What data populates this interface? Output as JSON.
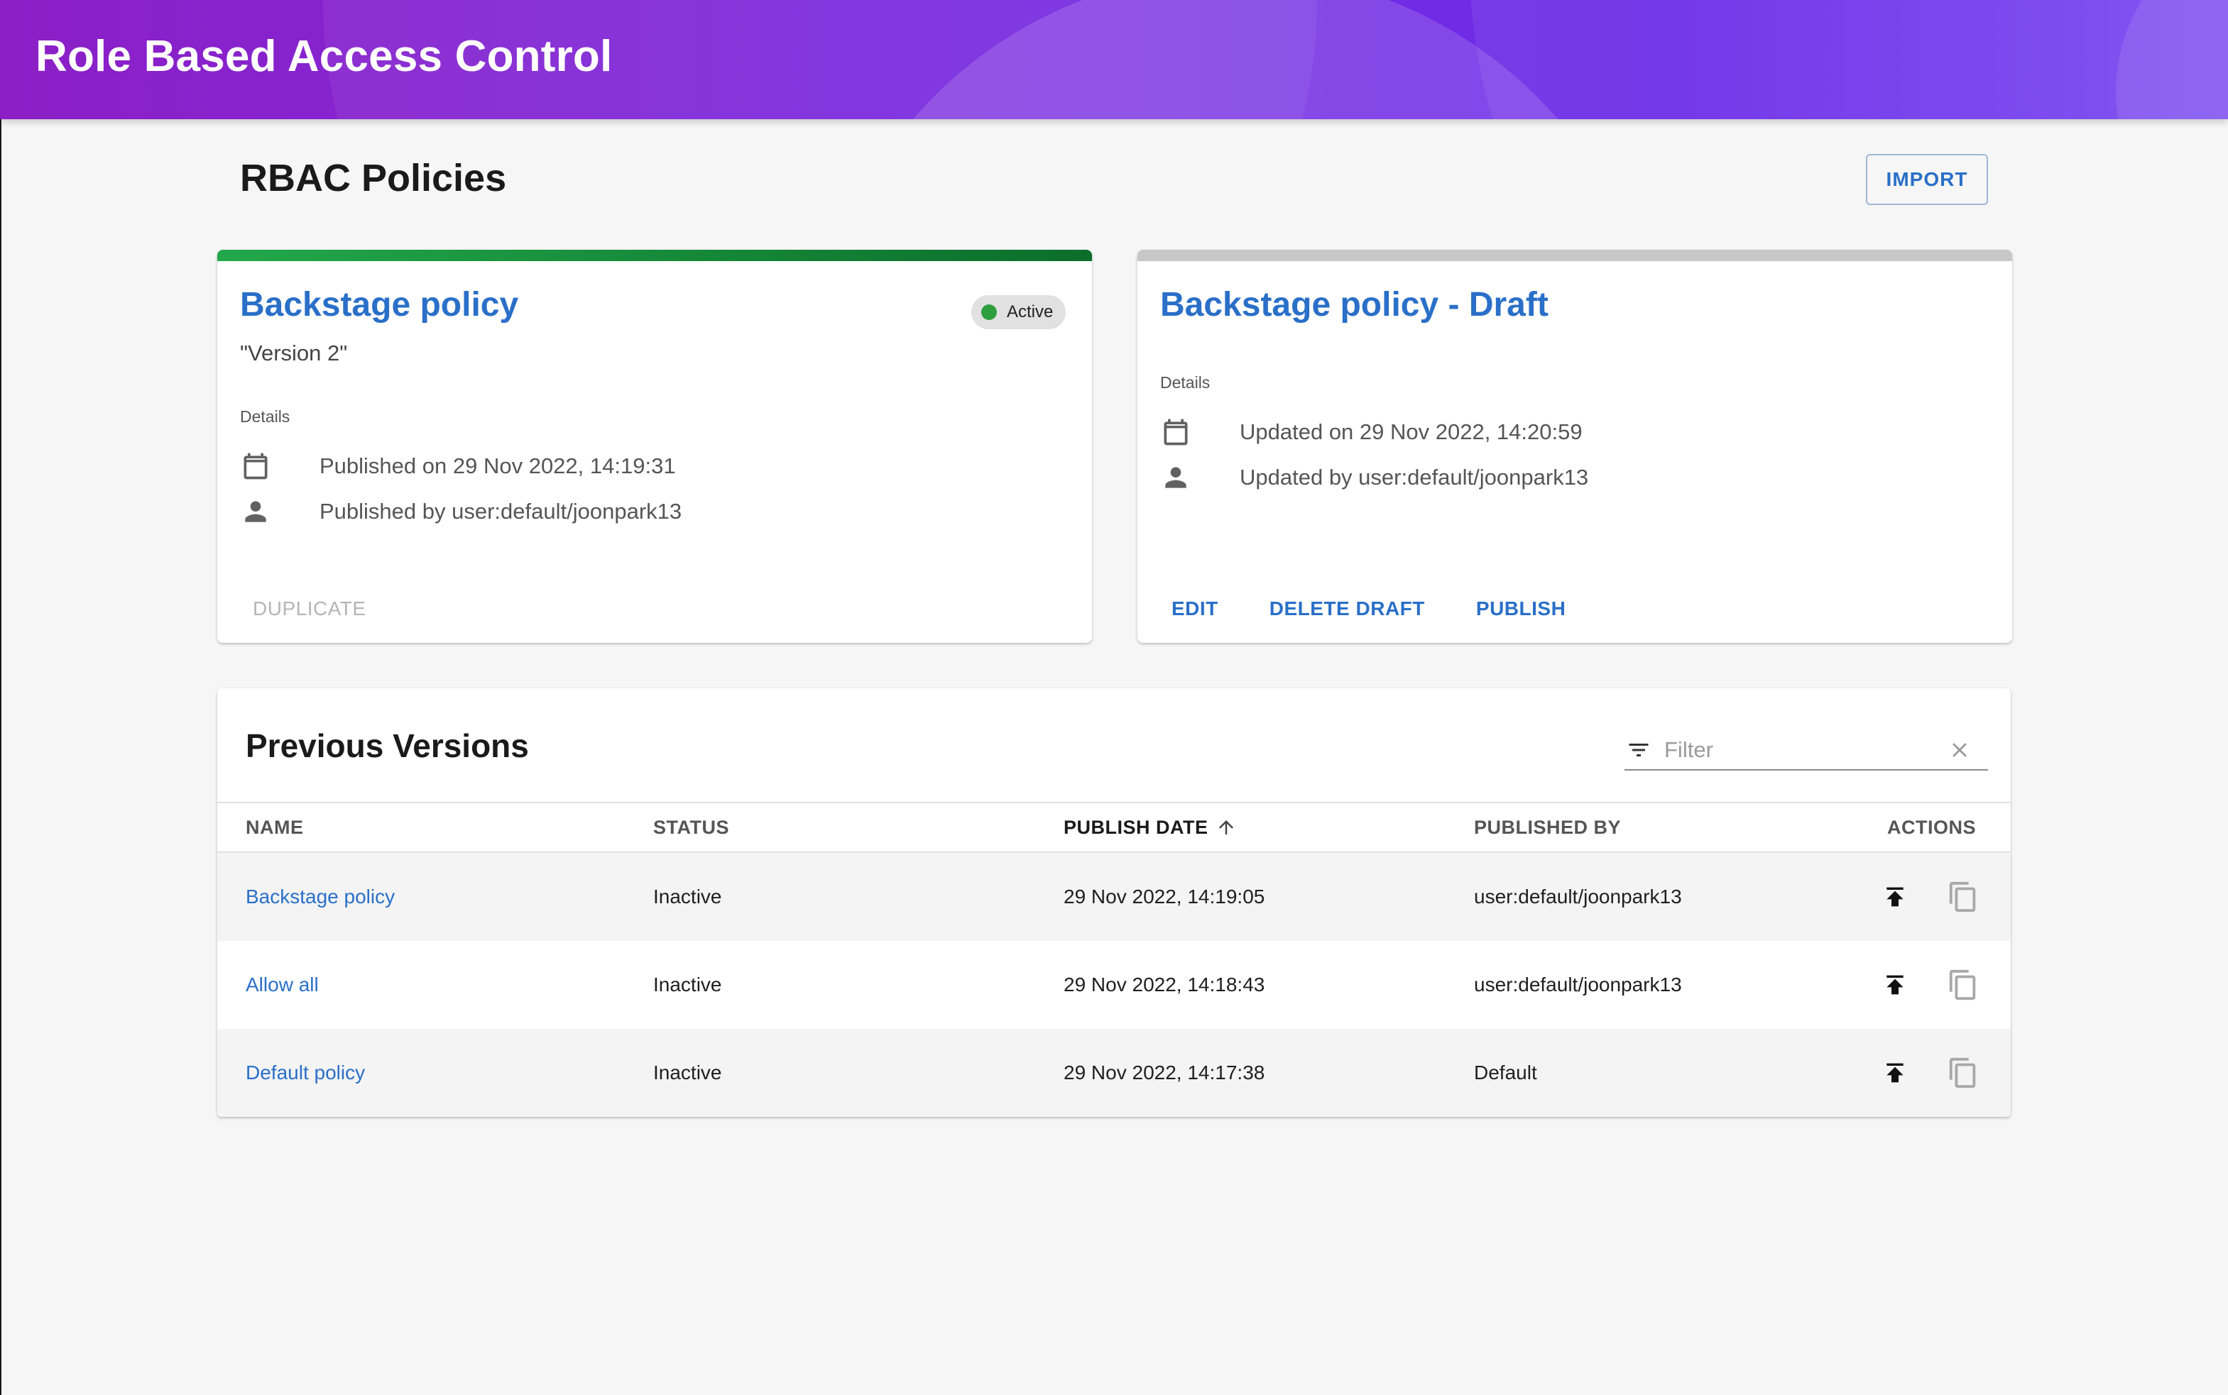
{
  "header": {
    "title": "Role Based Access Control"
  },
  "page": {
    "title": "RBAC Policies",
    "import_label": "IMPORT"
  },
  "active_card": {
    "title": "Backstage policy",
    "subtitle": "\"Version 2\"",
    "status": "Active",
    "details_label": "Details",
    "published_on": "Published on 29 Nov 2022, 14:19:31",
    "published_by": "Published by user:default/joonpark13",
    "actions": [
      "DUPLICATE"
    ]
  },
  "draft_card": {
    "title": "Backstage policy - Draft",
    "details_label": "Details",
    "updated_on": "Updated on 29 Nov 2022, 14:20:59",
    "updated_by": "Updated by user:default/joonpark13",
    "actions": [
      "EDIT",
      "DELETE DRAFT",
      "PUBLISH"
    ]
  },
  "versions": {
    "title": "Previous Versions",
    "filter_placeholder": "Filter",
    "columns": [
      "NAME",
      "STATUS",
      "PUBLISH DATE",
      "PUBLISHED BY",
      "ACTIONS"
    ],
    "rows": [
      {
        "name": "Backstage policy",
        "status": "Inactive",
        "publish_date": "29 Nov 2022, 14:19:05",
        "published_by": "user:default/joonpark13"
      },
      {
        "name": "Allow all",
        "status": "Inactive",
        "publish_date": "29 Nov 2022, 14:18:43",
        "published_by": "user:default/joonpark13"
      },
      {
        "name": "Default policy",
        "status": "Inactive",
        "publish_date": "29 Nov 2022, 14:17:38",
        "published_by": "Default"
      }
    ]
  },
  "colors": {
    "accent": "#2a6fc8",
    "active_green": "#2e9e3e",
    "header_start": "#8c1fc6",
    "header_end": "#7a48f0"
  },
  "icons": [
    "calendar-icon",
    "person-icon",
    "filter-icon",
    "close-icon",
    "arrow-up-icon",
    "publish-icon",
    "copy-icon"
  ]
}
